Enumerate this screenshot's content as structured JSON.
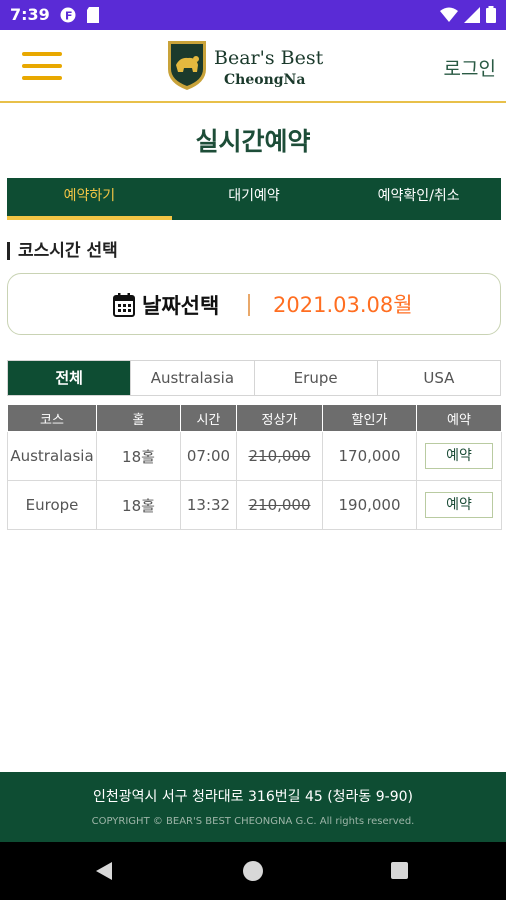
{
  "status_bar": {
    "time": "7:39",
    "icons": [
      "notification-f-icon",
      "sd-card-icon",
      "wifi-icon",
      "signal-icon",
      "battery-icon"
    ]
  },
  "header": {
    "logo_line1": "Bear's Best",
    "logo_line2": "CheongNa",
    "login": "로그인"
  },
  "page_title": "실시간예약",
  "main_tabs": [
    {
      "label": "예약하기",
      "active": true
    },
    {
      "label": "대기예약",
      "active": false
    },
    {
      "label": "예약확인/취소",
      "active": false
    }
  ],
  "section_title": "코스시간 선택",
  "date_picker": {
    "label": "날짜선택",
    "value": "2021.03.08월"
  },
  "course_tabs": [
    {
      "label": "전체",
      "active": true
    },
    {
      "label": "Australasia",
      "active": false
    },
    {
      "label": "Erupe",
      "active": false
    },
    {
      "label": "USA",
      "active": false
    }
  ],
  "table": {
    "headers": [
      "코스",
      "홀",
      "시간",
      "정상가",
      "할인가",
      "예약"
    ],
    "rows": [
      {
        "course": "Australasia",
        "hole": "18홀",
        "time": "07:00",
        "regular": "210,000",
        "discount": "170,000",
        "button": "예약"
      },
      {
        "course": "Europe",
        "hole": "18홀",
        "time": "13:32",
        "regular": "210,000",
        "discount": "190,000",
        "button": "예약"
      }
    ]
  },
  "footer": {
    "address": "인천광역시 서구 청라대로 316번길 45 (청라동 9-90)",
    "copyright": "COPYRIGHT © BEAR'S BEST CHEONGNA G.C. All rights reserved."
  },
  "colors": {
    "brand_green": "#0e4d33",
    "accent_yellow": "#f2c545",
    "date_orange": "#ff6e21",
    "status_bar": "#5a2bd6"
  }
}
